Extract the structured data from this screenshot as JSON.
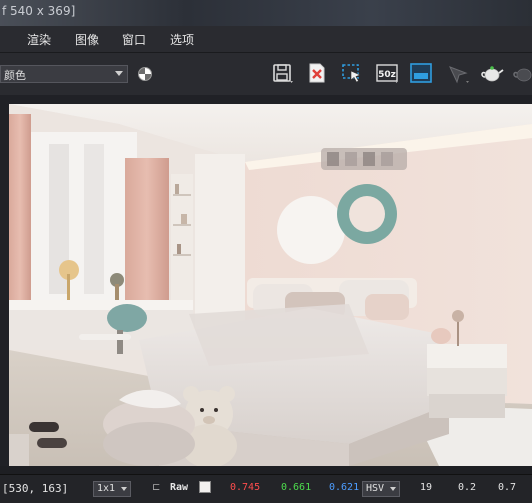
{
  "window": {
    "title": "f 540 x 369]"
  },
  "menu": {
    "items": [
      "渲染",
      "图像",
      "窗口",
      "选项"
    ]
  },
  "toolbar": {
    "channel_value": "颜色",
    "icons": {
      "mono": "monochrome-toggle-icon",
      "save": "save-icon",
      "clear": "clear-image-icon",
      "region": "region-render-icon",
      "history": "history-icon",
      "compare": "compare-icon",
      "track": "track-mouse-icon",
      "teapot": "render-teapot-icon",
      "teapot2": "render-teapot-alt-icon"
    },
    "history_label": "50z"
  },
  "statusbar": {
    "coords": "[530, 163]",
    "zoom": "1x1",
    "raw_label": "Raw",
    "r": "0.745",
    "g": "0.661",
    "b": "0.621",
    "mode": "HSV",
    "h": "19",
    "s": "0.2",
    "v": "0.7"
  },
  "colors": {
    "r_value": "#ff4d4d",
    "g_value": "#4ddc4d",
    "b_value": "#4d9dff",
    "accent_blue": "#2f9de0",
    "clear_red": "#e0403a"
  }
}
